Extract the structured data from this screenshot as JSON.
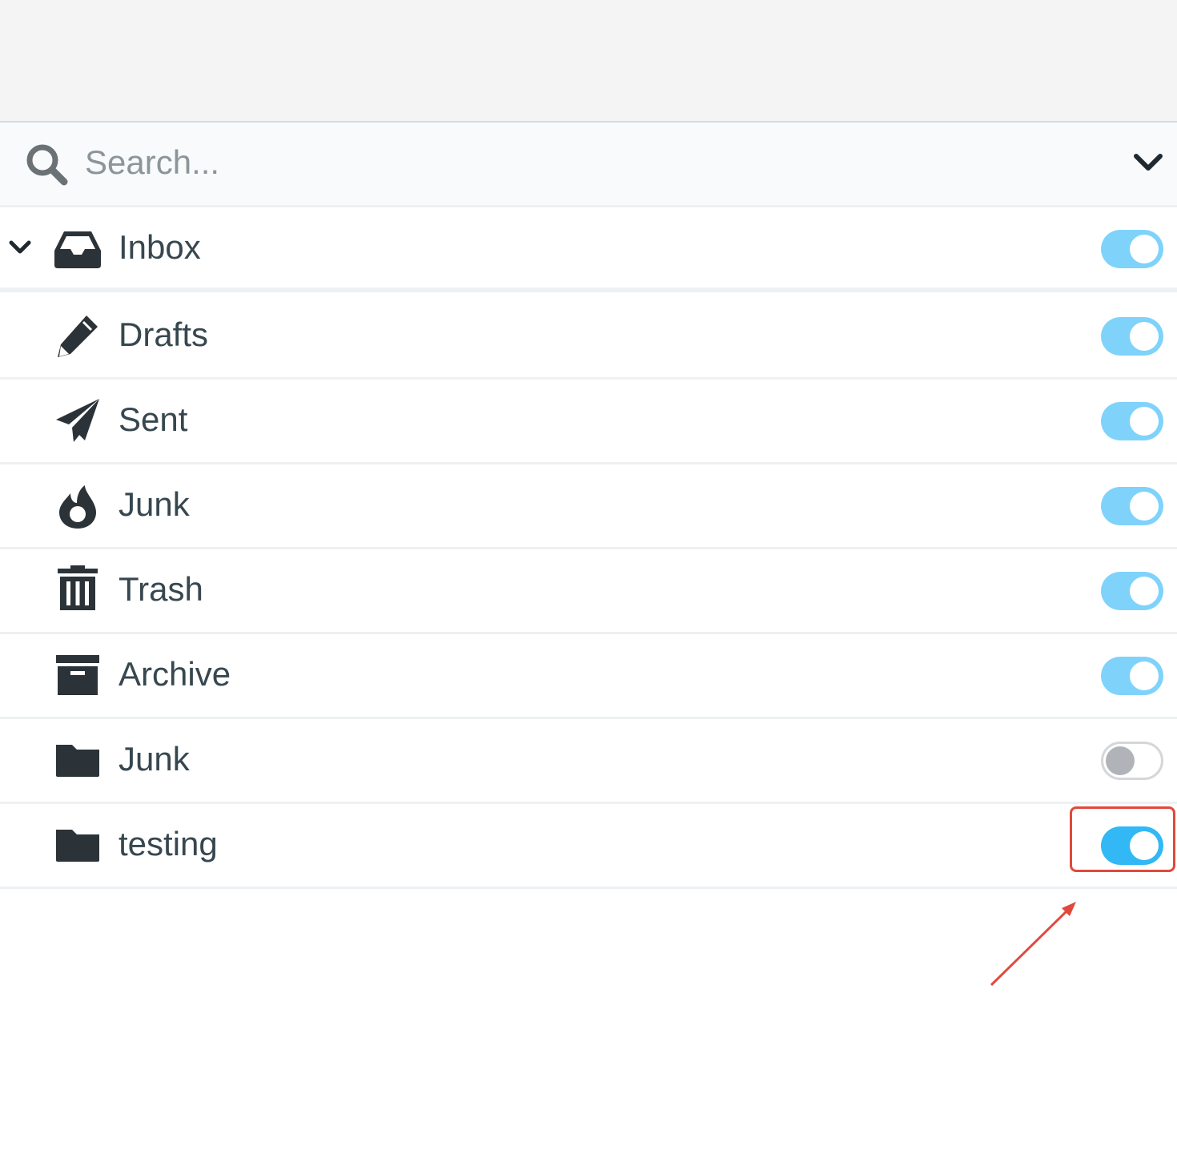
{
  "search": {
    "placeholder": "Search..."
  },
  "folders": [
    {
      "name": "Inbox",
      "icon": "inbox-icon",
      "subscribed": true,
      "expandable": true
    },
    {
      "name": "Drafts",
      "icon": "pencil-icon",
      "subscribed": true
    },
    {
      "name": "Sent",
      "icon": "paper-plane-icon",
      "subscribed": true
    },
    {
      "name": "Junk",
      "icon": "fire-icon",
      "subscribed": true
    },
    {
      "name": "Trash",
      "icon": "trash-icon",
      "subscribed": true
    },
    {
      "name": "Archive",
      "icon": "archive-icon",
      "subscribed": true
    },
    {
      "name": "Junk",
      "icon": "folder-icon",
      "subscribed": false
    },
    {
      "name": "testing",
      "icon": "folder-icon",
      "subscribed": true
    }
  ],
  "colors": {
    "toggle_on": "#7fd3fb",
    "toggle_on_active": "#31b8f5",
    "toggle_off_border": "#d4d7d9",
    "highlight": "#e04a3c"
  }
}
